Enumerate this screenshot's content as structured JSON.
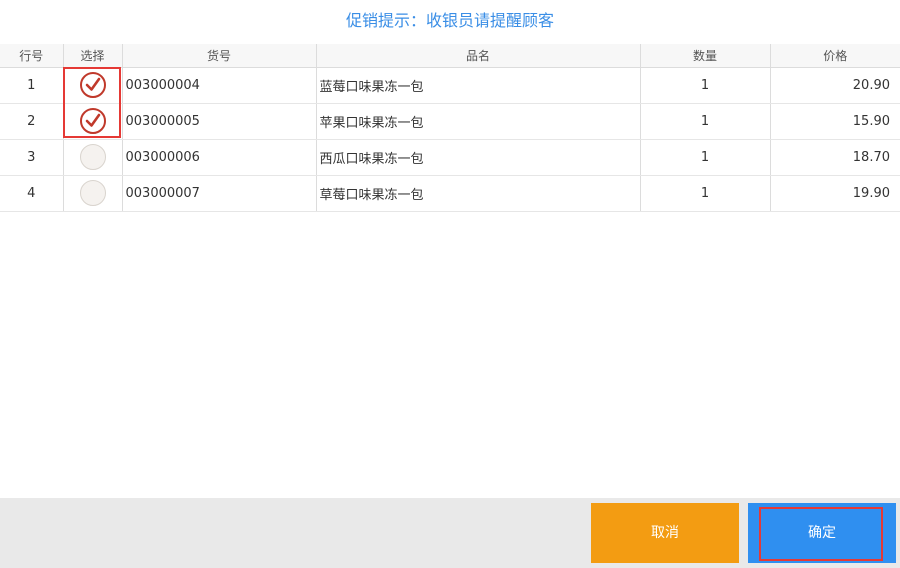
{
  "title": "促销提示：收银员请提醒顾客",
  "table": {
    "headers": [
      "行号",
      "选择",
      "货号",
      "品名",
      "数量",
      "价格"
    ],
    "rows": [
      {
        "line": "1",
        "selected": true,
        "code": "003000004",
        "name": "蓝莓口味果冻一包",
        "qty": "1",
        "price": "20.90"
      },
      {
        "line": "2",
        "selected": true,
        "code": "003000005",
        "name": "苹果口味果冻一包",
        "qty": "1",
        "price": "15.90"
      },
      {
        "line": "3",
        "selected": false,
        "code": "003000006",
        "name": "西瓜口味果冻一包",
        "qty": "1",
        "price": "18.70"
      },
      {
        "line": "4",
        "selected": false,
        "code": "003000007",
        "name": "草莓口味果冻一包",
        "qty": "1",
        "price": "19.90"
      }
    ]
  },
  "buttons": {
    "cancel": "取消",
    "ok": "确定"
  },
  "icons": {
    "checked": "check-circle-icon",
    "unchecked": "empty-circle-icon"
  },
  "colors": {
    "accent": "#3a8ee6",
    "check": "#c0392b",
    "cancel": "#f39c12",
    "ok": "#2f8ff0",
    "highlight": "#e53935"
  }
}
